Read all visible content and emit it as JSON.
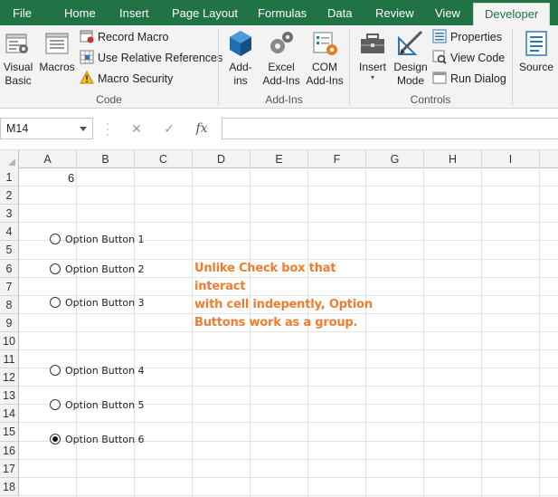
{
  "tabs": [
    "File",
    "Home",
    "Insert",
    "Page Layout",
    "Formulas",
    "Data",
    "Review",
    "View",
    "Developer"
  ],
  "active_tab": "Developer",
  "ribbon": {
    "code": {
      "label": "Code",
      "visual_basic": "Visual Basic",
      "visual_basic_l1": "Visual",
      "visual_basic_l2": "Basic",
      "macros": "Macros",
      "record_macro": "Record Macro",
      "use_relative": "Use Relative References",
      "macro_security": "Macro Security"
    },
    "addins": {
      "label": "Add-Ins",
      "addins_l1": "Add-",
      "addins_l2": "ins",
      "excel_l1": "Excel",
      "excel_l2": "Add-Ins",
      "com_l1": "COM",
      "com_l2": "Add-Ins"
    },
    "controls": {
      "label": "Controls",
      "insert": "Insert",
      "design_l1": "Design",
      "design_l2": "Mode",
      "properties": "Properties",
      "view_code": "View Code",
      "run_dialog": "Run Dialog"
    },
    "xml": {
      "source": "Source"
    }
  },
  "formula_bar": {
    "name_box": "M14",
    "cancel_glyph": "✕",
    "enter_glyph": "✓",
    "fx_glyph": "fx",
    "formula": ""
  },
  "columns": [
    "A",
    "B",
    "C",
    "D",
    "E",
    "F",
    "G",
    "H",
    "I"
  ],
  "rows": [
    "1",
    "2",
    "3",
    "4",
    "5",
    "6",
    "7",
    "8",
    "9",
    "10",
    "11",
    "12",
    "13",
    "14",
    "15",
    "16",
    "17",
    "18"
  ],
  "cells": {
    "A1": "6"
  },
  "option_buttons": [
    {
      "label": "Option Button 1",
      "checked": false
    },
    {
      "label": "Option Button 2",
      "checked": false
    },
    {
      "label": "Option Button 3",
      "checked": false
    },
    {
      "label": "Option Button 4",
      "checked": false
    },
    {
      "label": "Option Button 5",
      "checked": false
    },
    {
      "label": "Option Button 6",
      "checked": true
    }
  ],
  "note_lines": [
    "Unlike Check box that interact",
    "with cell indepently, Option",
    "Buttons work as a group."
  ],
  "colors": {
    "brand": "#217346",
    "note": "#ed7d31"
  }
}
